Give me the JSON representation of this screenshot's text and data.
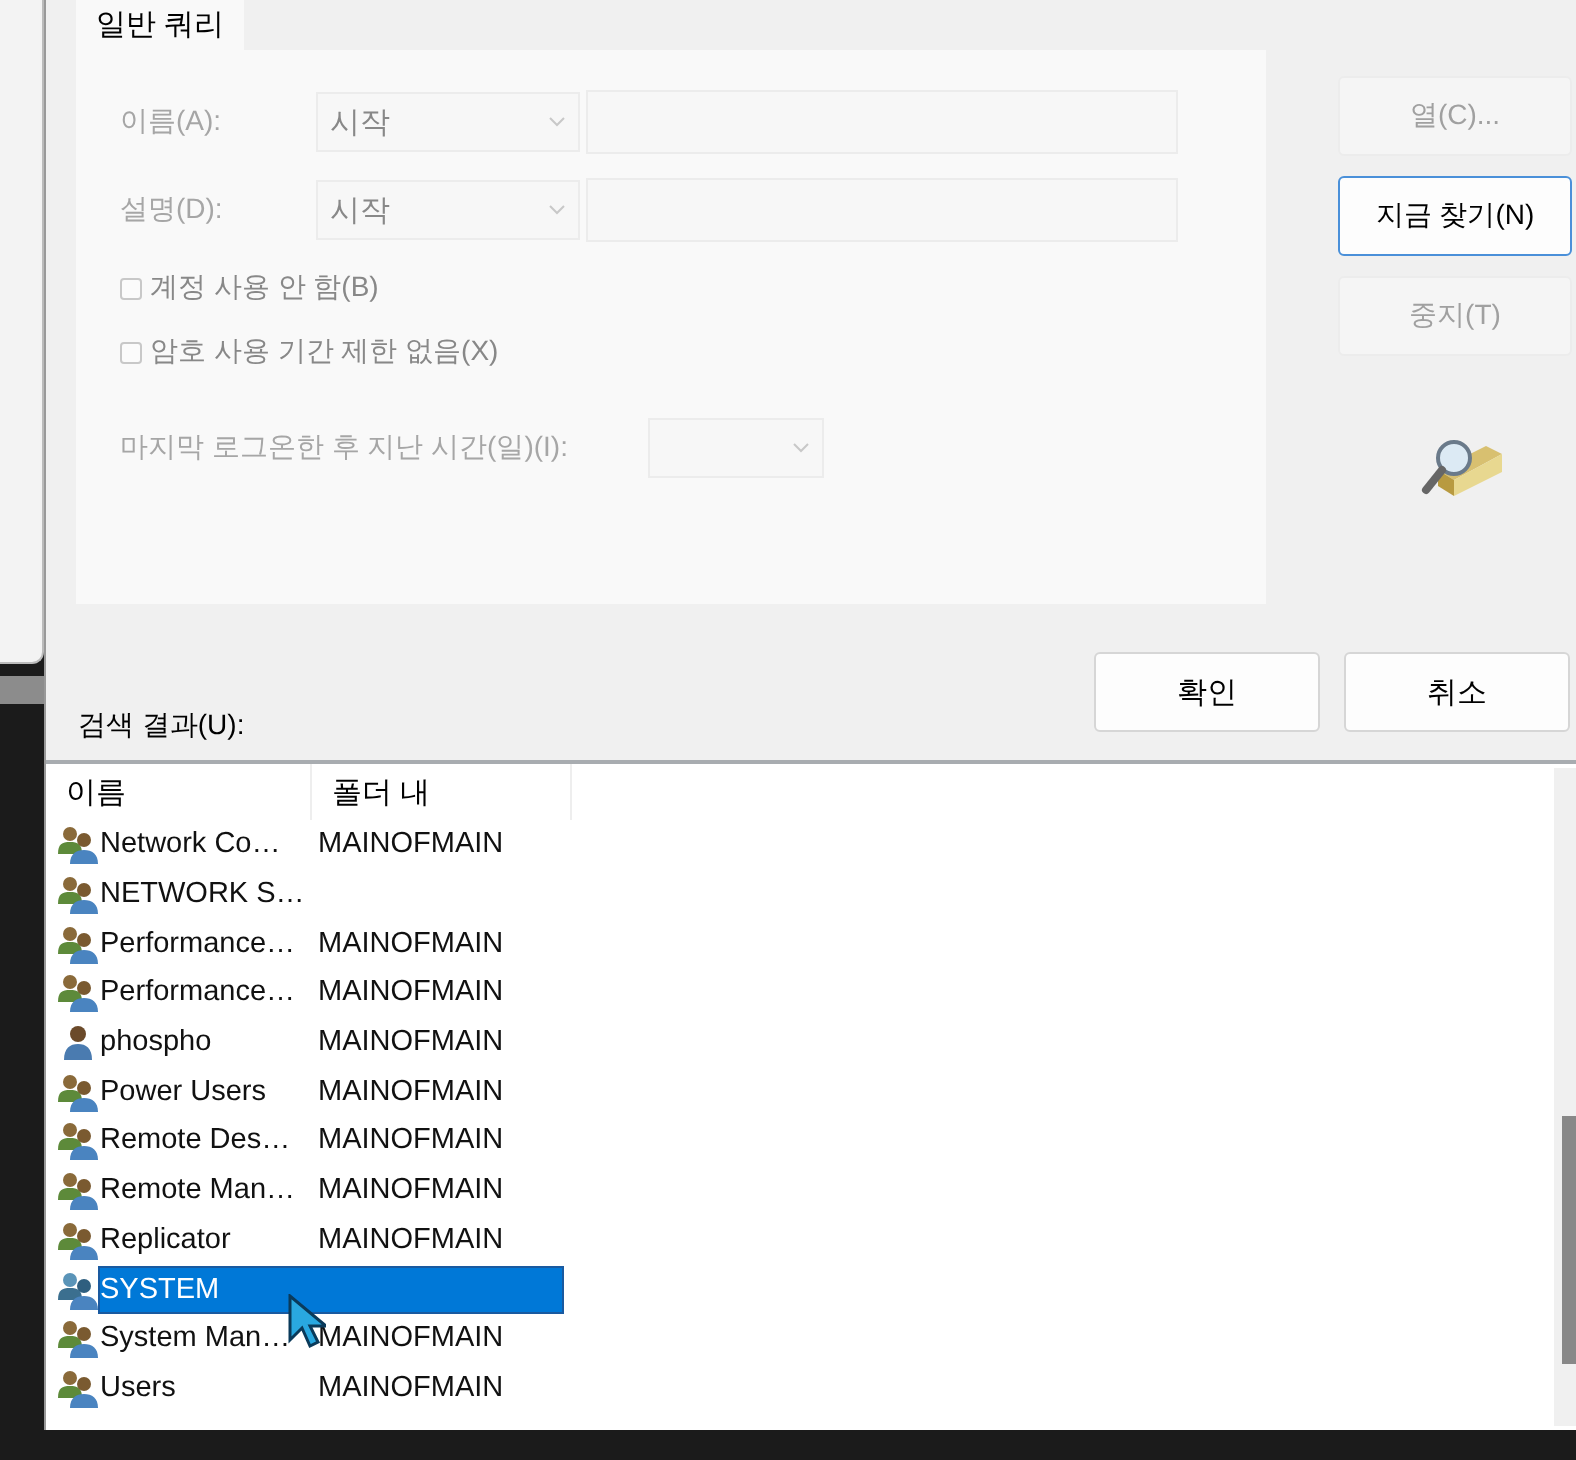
{
  "tab": {
    "label": "일반 쿼리",
    "selected": true
  },
  "fields": [
    {
      "label": "이름(A):",
      "mode": "시작"
    },
    {
      "label": "설명(D):",
      "mode": "시작"
    }
  ],
  "checkboxes": [
    {
      "label": "계정 사용 안 함(B)",
      "checked": false,
      "disabled": true
    },
    {
      "label": "암호 사용 기간 제한 없음(X)",
      "checked": false,
      "disabled": true
    }
  ],
  "last_logon": {
    "label": "마지막 로그온한 후 지난 시간(일)(I):",
    "disabled": true
  },
  "side_buttons": [
    {
      "label": "열(C)...",
      "disabled": true,
      "default": false
    },
    {
      "label": "지금 찾기(N)",
      "disabled": false,
      "default": true
    },
    {
      "label": "중지(T)",
      "disabled": true,
      "default": false
    }
  ],
  "dialog_buttons": [
    "확인",
    "취소"
  ],
  "results_label": "검색 결과(U):",
  "columns": [
    "이름",
    "폴더 내"
  ],
  "rows": [
    {
      "kind": "group",
      "name": "Network Co…",
      "folder": "MAINOFMAIN",
      "selected": false
    },
    {
      "kind": "group",
      "name": "NETWORK S…",
      "selected": false
    },
    {
      "kind": "group",
      "name": "Performance…",
      "folder": "MAINOFMAIN",
      "selected": false
    },
    {
      "kind": "group",
      "name": "Performance…",
      "folder": "MAINOFMAIN",
      "selected": false
    },
    {
      "kind": "user",
      "name": "phospho",
      "folder": "MAINOFMAIN",
      "selected": false
    },
    {
      "kind": "group",
      "name": "Power Users",
      "folder": "MAINOFMAIN",
      "selected": false
    },
    {
      "kind": "group",
      "name": "Remote Des…",
      "folder": "MAINOFMAIN",
      "selected": false
    },
    {
      "kind": "group",
      "name": "Remote Man…",
      "folder": "MAINOFMAIN",
      "selected": false
    },
    {
      "kind": "group",
      "name": "Replicator",
      "folder": "MAINOFMAIN",
      "selected": false
    },
    {
      "kind": "system",
      "name": "SYSTEM",
      "selected": true
    },
    {
      "kind": "group",
      "name": "System Man…",
      "folder": "MAINOFMAIN",
      "selected": false
    },
    {
      "kind": "group",
      "name": "Users",
      "folder": "MAINOFMAIN",
      "selected": false
    }
  ]
}
